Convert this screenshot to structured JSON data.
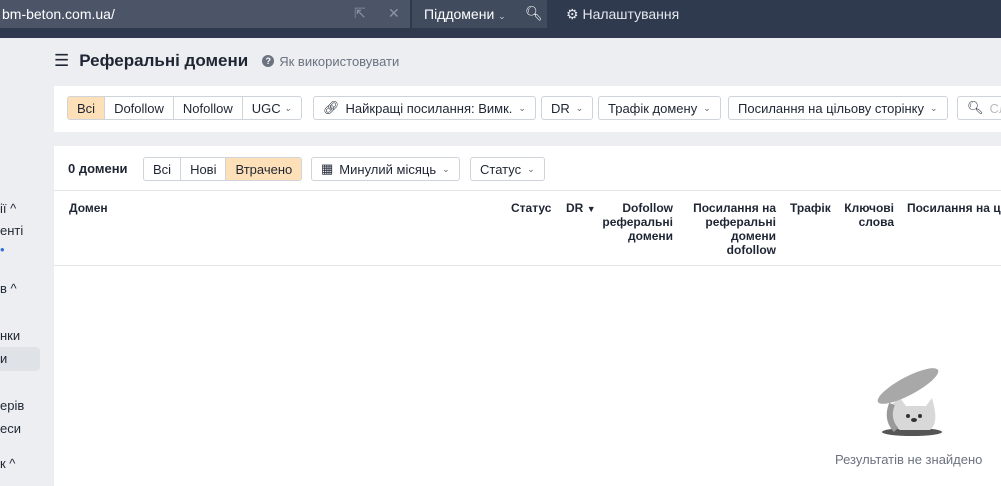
{
  "topbar": {
    "url": "bm-beton.com.ua/",
    "subdomains": "Піддомени",
    "settings": "Налаштування"
  },
  "sidebar": {
    "items": [
      "ії",
      "енті",
      "в",
      "нки",
      "и",
      "ерів",
      "еси",
      "к"
    ]
  },
  "header": {
    "title": "Реферальні домени",
    "how_to": "Як використовувати"
  },
  "filters": {
    "link_types": [
      "Всі",
      "Dofollow",
      "Nofollow",
      "UGC"
    ],
    "best_links": "Найкращі посилання: Вимк.",
    "dr": "DR",
    "domain_traffic": "Трафік домену",
    "target_links": "Посилання на цільову сторінку",
    "search_placeholder": "Сл"
  },
  "results": {
    "count": "0 домени",
    "tabs": [
      "Всі",
      "Нові",
      "Втрачено"
    ],
    "period": "Минулий місяць",
    "status": "Статус"
  },
  "table": {
    "columns": [
      "Домен",
      "Статус",
      "DR",
      "Dofollow реферальні домени",
      "Посилання на реферальні домени dofollow",
      "Трафік",
      "Ключові слова",
      "Посилання на ці"
    ]
  },
  "empty_text": "Результатів не знайдено",
  "colors": {
    "active": "#fde0b8",
    "topbar": "#2f3a4f"
  }
}
